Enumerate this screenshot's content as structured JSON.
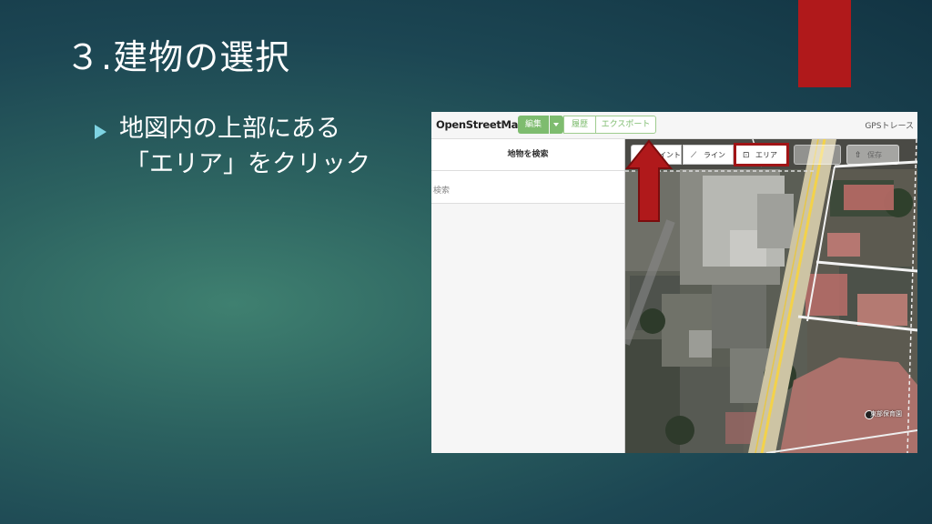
{
  "slide": {
    "title": "３.建物の選択",
    "bullet_line1": "地図内の上部にある",
    "bullet_line2": "「エリア」をクリック",
    "accent_color": "#b0191b",
    "bullet_color": "#7ed3e2"
  },
  "osm": {
    "logo": "OpenStreetMap",
    "edit_button": "編集",
    "history_tab": "履歴",
    "export_tab": "エクスポート",
    "gps_link": "GPSトレース",
    "sidebar_title": "地物を検索",
    "search_placeholder": "検索",
    "toolbar": {
      "point": "ポイント",
      "line": "ライン",
      "area": "エリア",
      "save": "保存"
    },
    "poi_name": "東部保育園",
    "icons": [
      "map-pin-icon",
      "line-draw-icon",
      "area-polygon-icon",
      "note-icon",
      "upload-icon",
      "up-arrow-icon",
      "poi-icon"
    ]
  }
}
